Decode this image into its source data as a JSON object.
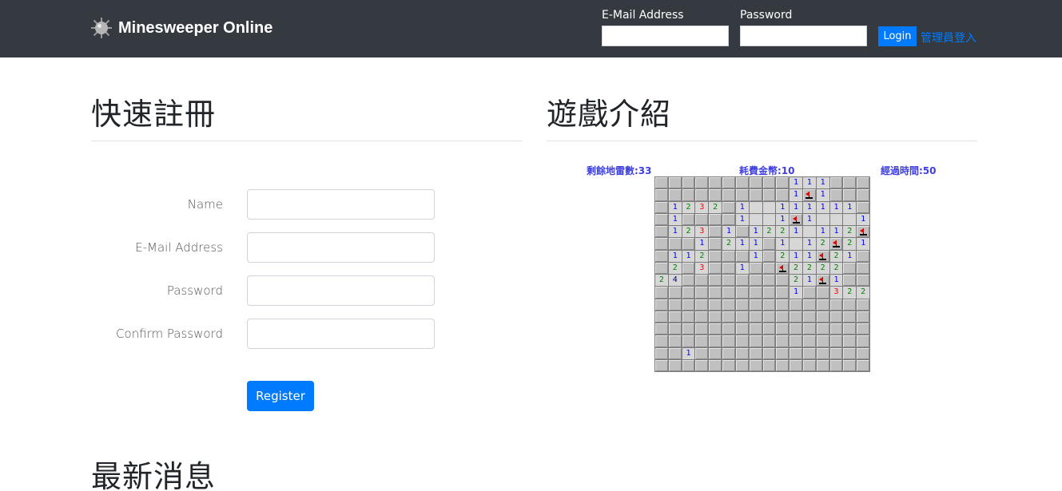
{
  "navbar": {
    "brand": "Minesweeper Online",
    "email_label": "E-Mail Address",
    "password_label": "Password",
    "login_label": "Login",
    "admin_link": "管理員登入"
  },
  "register": {
    "title": "快速註冊",
    "fields": [
      {
        "label": "Name"
      },
      {
        "label": "E-Mail Address"
      },
      {
        "label": "Password"
      },
      {
        "label": "Confirm Password"
      }
    ],
    "submit_label": "Register"
  },
  "intro": {
    "title": "遊戲介紹",
    "remaining_mines": "剩餘地雷數:33",
    "coins_spent": "耗費金幣:10",
    "elapsed_time": "經過時間:50"
  },
  "news": {
    "title": "最新消息"
  },
  "board": {
    "rows": 16,
    "cols": 16,
    "legend": "# = covered, . = open empty, F = flag, digit = open number",
    "grid": [
      "##########111###",
      "##########1F1###",
      "#1232#1..111111#",
      "#1####1..1F1...11",
      "#123#1#1221.112F",
      "###1#211#1.12F21",
      "#112###1#211F21#",
      "#2#3##1##F2222##",
      "24########21F1##",
      "##########1##322",
      "################",
      "################",
      "################",
      "################",
      "##1#############",
      "################"
    ]
  }
}
